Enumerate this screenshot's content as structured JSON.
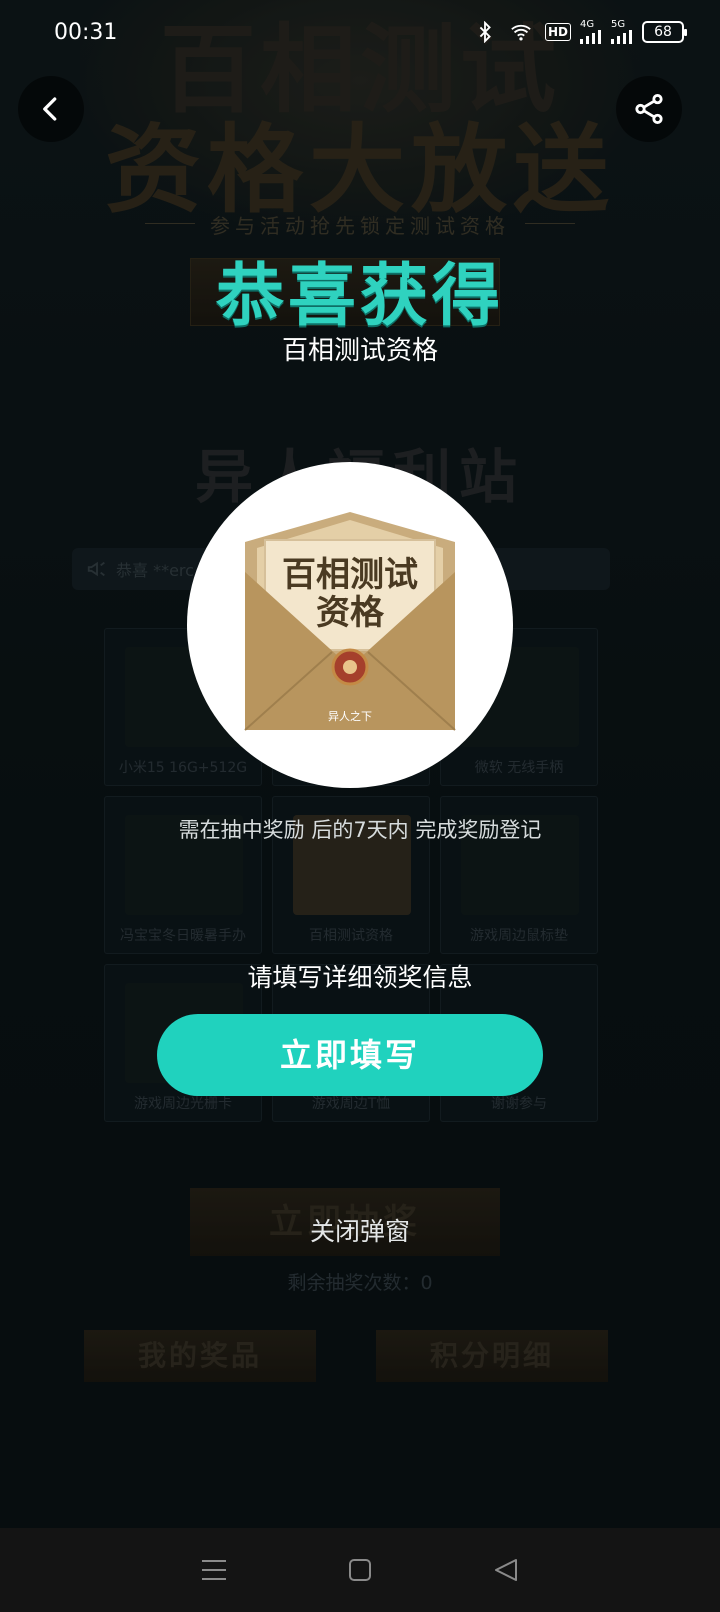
{
  "status_bar": {
    "time": "00:31",
    "hd_label": "HD",
    "net1_label": "4G",
    "net2_label": "5G",
    "battery": "68"
  },
  "background": {
    "hero_line1": "百相测试",
    "hero_line2": "资格大放送",
    "hero_subtitle": "参与活动抢先锁定测试资格",
    "section_title": "异人福利站",
    "marquee_text": "恭喜 **erc",
    "prizes": [
      {
        "label": "小米15 16G+512G"
      },
      {
        "label": ""
      },
      {
        "label": "微软 无线手柄"
      },
      {
        "label": "冯宝宝冬日暖暑手办"
      },
      {
        "label": "百相测试资格"
      },
      {
        "label": "游戏周边鼠标垫"
      },
      {
        "label": "游戏周边光栅卡"
      },
      {
        "label": "游戏周边T恤"
      },
      {
        "label": "谢谢参与"
      }
    ],
    "draw_button": "立即抽奖",
    "remaining_label": "剩余抽奖次数：",
    "remaining_count": "0",
    "my_prizes_button": "我的奖品",
    "points_detail_button": "积分明细"
  },
  "modal": {
    "title": "恭喜获得",
    "prize_name": "百相测试资格",
    "prize_image_text_line1": "百相测试",
    "prize_image_text_line2": "资格",
    "prize_image_seal_text": "异人之下",
    "notice": "需在抽中奖励 后的7天内 完成奖励登记",
    "fill_tip": "请填写详细领奖信息",
    "fill_button": "立即填写",
    "close_button": "关闭弹窗"
  },
  "colors": {
    "accent": "#20d2be",
    "title_teal": "#2fd2bf"
  }
}
